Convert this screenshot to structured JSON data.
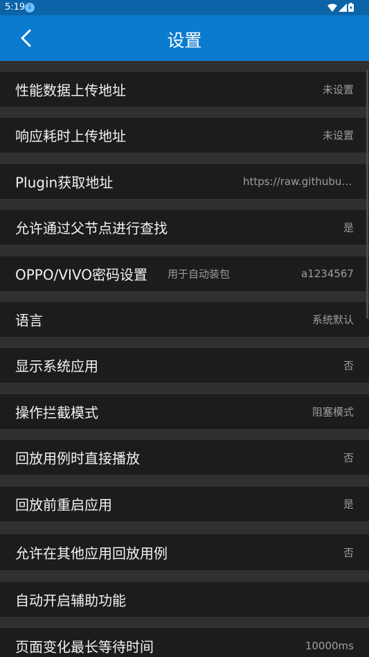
{
  "status": {
    "time": "5:19"
  },
  "appbar": {
    "title": "设置"
  },
  "settings": [
    {
      "label": "性能数据上传地址",
      "value": "未设置"
    },
    {
      "label": "响应耗时上传地址",
      "value": "未设置"
    },
    {
      "label": "Plugin获取地址",
      "value": "https://raw.githubus…"
    },
    {
      "label": "允许通过父节点进行查找",
      "value": "是"
    },
    {
      "label": "OPPO/VIVO密码设置",
      "hint": "用于自动装包",
      "value": "a1234567"
    },
    {
      "label": "语言",
      "value": "系统默认"
    },
    {
      "label": "显示系统应用",
      "value": "否"
    },
    {
      "label": "操作拦截模式",
      "value": "阻塞模式"
    },
    {
      "label": "回放用例时直接播放",
      "value": "否"
    },
    {
      "label": "回放前重启应用",
      "value": "是"
    },
    {
      "label": "允许在其他应用回放用例",
      "value": "否"
    },
    {
      "label": "自动开启辅助功能",
      "value": ""
    },
    {
      "label": "页面变化最长等待时间",
      "value": "10000ms"
    }
  ]
}
